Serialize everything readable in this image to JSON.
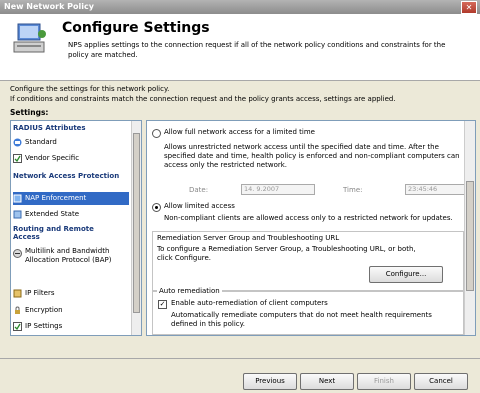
{
  "window": {
    "title": "New Network Policy",
    "close_glyph": "✕"
  },
  "header": {
    "title": "Configure Settings",
    "description": "NPS applies settings to the connection request if all of the network policy conditions and constraints for the policy are matched."
  },
  "intro": {
    "line1": "Configure the settings for this network policy.",
    "line2": "If conditions and constraints match the connection request and the policy grants access, settings are applied."
  },
  "settings_label": "Settings:",
  "sidebar": {
    "sections": [
      {
        "label": "RADIUS Attributes"
      },
      {
        "label": "Network Access Protection"
      },
      {
        "label": "Routing and Remote Access"
      }
    ],
    "items": [
      {
        "label": "Standard",
        "icon": "standard-icon"
      },
      {
        "label": "Vendor Specific",
        "icon": "vendor-specific-icon"
      },
      {
        "label": "NAP Enforcement",
        "icon": "nap-enforcement-icon"
      },
      {
        "label": "Extended State",
        "icon": "extended-state-icon"
      },
      {
        "label": "Multilink and Bandwidth Allocation Protocol (BAP)",
        "icon": "multilink-icon"
      },
      {
        "label": "IP Filters",
        "icon": "ip-filters-icon"
      },
      {
        "label": "Encryption",
        "icon": "encryption-icon"
      },
      {
        "label": "IP Settings",
        "icon": "ip-settings-icon"
      }
    ]
  },
  "main": {
    "full_access_label": "Allow full network access for a limited time",
    "full_access_desc": "Allows unrestricted network access until the specified date and time. After the specified date and time, health policy is enforced and non-compliant computers can access only the restricted network.",
    "date_label": "Date:",
    "date_value": "14. 9.2007",
    "time_label": "Time:",
    "time_value": "23:45:46",
    "limited_access_label": "Allow limited access",
    "limited_access_desc": "Non-compliant clients are allowed access only to a restricted network for updates.",
    "remediation_group_title": "Remediation Server Group and Troubleshooting URL",
    "remediation_group_desc": "To configure a Remediation Server Group, a Troubleshooting URL, or both, click Configure.",
    "configure_button": "Configure...",
    "auto_remediation_title": "Auto remediation",
    "auto_remediation_checkbox": "Enable auto-remediation of client computers",
    "auto_remediation_desc": "Automatically remediate computers that do not meet health requirements defined in this policy."
  },
  "buttons": {
    "previous": "Previous",
    "next": "Next",
    "finish": "Finish",
    "cancel": "Cancel"
  },
  "colors": {
    "selection": "#316ac5",
    "section_text": "#1a3a7a"
  }
}
